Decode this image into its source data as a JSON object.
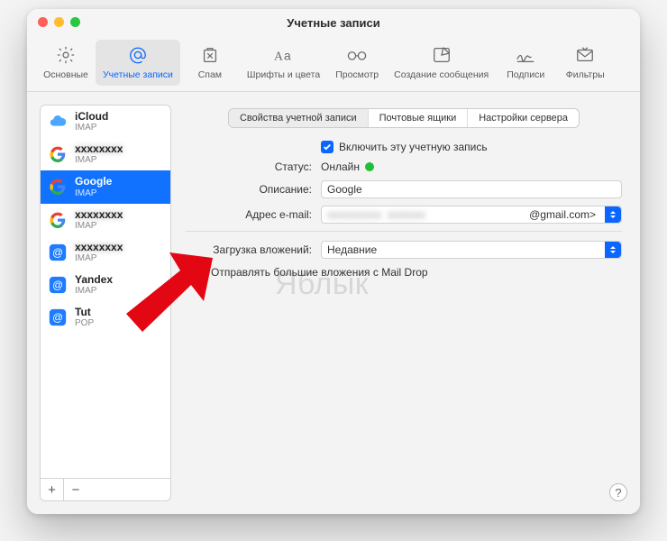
{
  "window": {
    "title": "Учетные записи"
  },
  "toolbar": {
    "items": [
      {
        "label": "Основные"
      },
      {
        "label": "Учетные записи"
      },
      {
        "label": "Спам"
      },
      {
        "label": "Шрифты и цвета"
      },
      {
        "label": "Просмотр"
      },
      {
        "label": "Создание сообщения"
      },
      {
        "label": "Подписи"
      },
      {
        "label": "Фильтры"
      }
    ]
  },
  "sidebar": {
    "accounts": [
      {
        "name": "iCloud",
        "proto": "IMAP",
        "icon": "icloud"
      },
      {
        "name": "",
        "proto": "IMAP",
        "icon": "google"
      },
      {
        "name": "Google",
        "proto": "IMAP",
        "icon": "google",
        "selected": true
      },
      {
        "name": "",
        "proto": "IMAP",
        "icon": "google"
      },
      {
        "name": "",
        "proto": "IMAP",
        "icon": "at"
      },
      {
        "name": "Yandex",
        "proto": "IMAP",
        "icon": "at"
      },
      {
        "name": "Tut",
        "proto": "POP",
        "icon": "at"
      }
    ],
    "add": "+",
    "remove": "−"
  },
  "segmented": {
    "items": [
      {
        "label": "Свойства учетной записи",
        "active": true
      },
      {
        "label": "Почтовые ящики"
      },
      {
        "label": "Настройки сервера"
      }
    ]
  },
  "form": {
    "enable_label": "Включить эту учетную запись",
    "status_label": "Статус:",
    "status_value": "Онлайн",
    "description_label": "Описание:",
    "description_value": "Google",
    "email_label": "Адрес e-mail:",
    "email_value": "@gmail.com>",
    "download_label": "Загрузка вложений:",
    "download_value": "Недавние",
    "maildrop_label": "Отправлять большие вложения с Mail Drop"
  },
  "watermark": "Яблык",
  "help": "?"
}
